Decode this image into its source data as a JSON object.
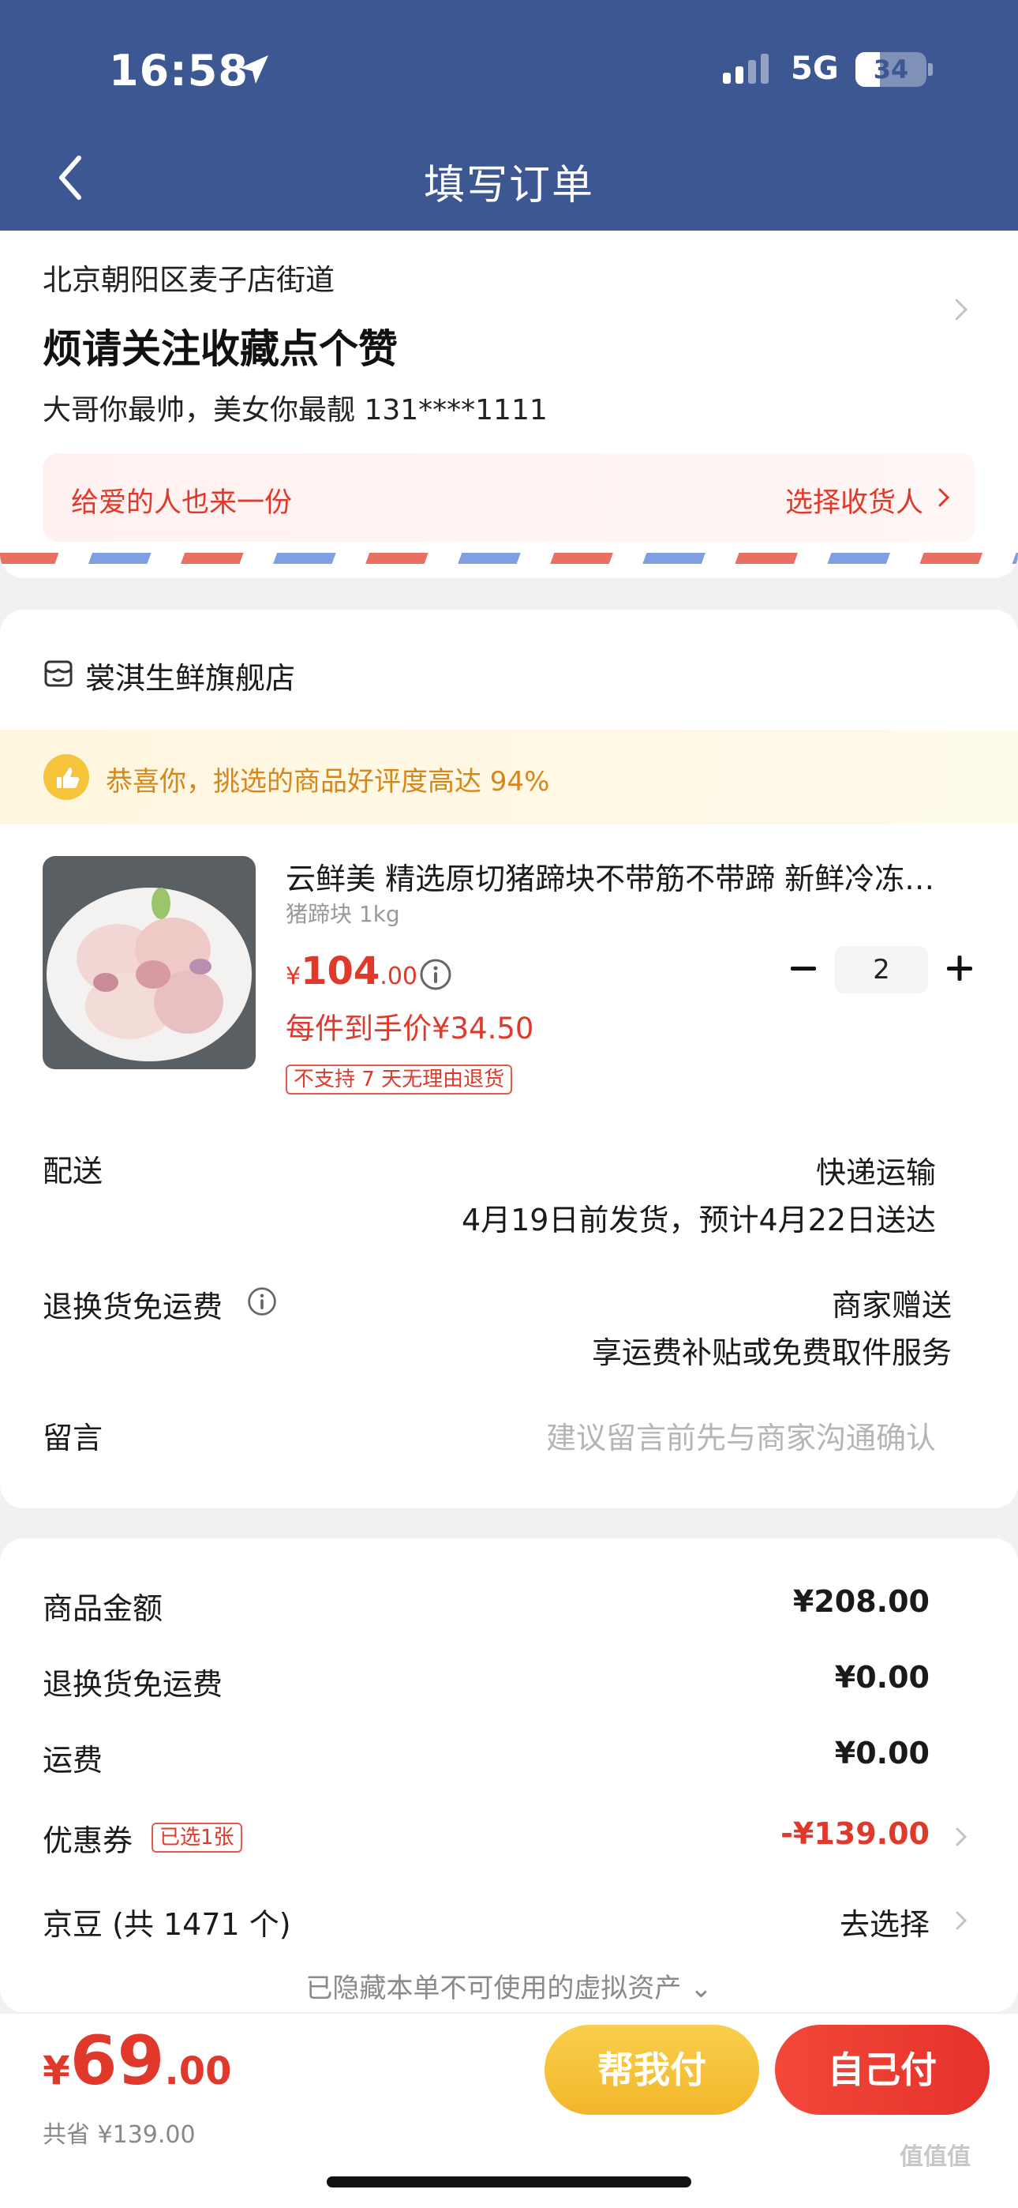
{
  "status_bar": {
    "time": "16:58",
    "network": "5G",
    "battery": "34",
    "battery_level": 0.34
  },
  "nav": {
    "title": "填写订单",
    "back_icon": "chevron-left-icon"
  },
  "address": {
    "region": "北京朝阳区麦子店街道",
    "detail": "烦请关注收藏点个赞",
    "contact": "大哥你最帅，美女你最靓  131****1111",
    "gift_prompt": "给爱的人也来一份",
    "choose_receiver": "选择收货人"
  },
  "shop": {
    "name": "裳淇生鲜旗舰店",
    "praise": "恭喜你，挑选的商品好评度高达 94%"
  },
  "product": {
    "title": "云鲜美 精选原切猪蹄块不带筋不带蹄 新鲜冷冻猪蹄块",
    "spec": "猪蹄块 1kg",
    "price_currency": "¥",
    "price_int": "104",
    "price_dec": ".00",
    "unit_price": "每件到手价¥34.50",
    "no_return_badge": "不支持 7 天无理由退货",
    "quantity": "2"
  },
  "delivery": {
    "label": "配送",
    "method": "快递运输",
    "eta": "4月19日前发货，预计4月22日送达"
  },
  "return_fee": {
    "label": "退换货免运费",
    "value": "商家赠送",
    "desc": "享运费补贴或免费取件服务"
  },
  "note": {
    "label": "留言",
    "placeholder": "建议留言前先与商家沟通确认"
  },
  "totals": {
    "goods_label": "商品金额",
    "goods_value": "¥208.00",
    "rfee_label": "退换货免运费",
    "rfee_value": "¥0.00",
    "ship_label": "运费",
    "ship_value": "¥0.00",
    "coupon_label": "优惠券",
    "coupon_badge": "已选1张",
    "coupon_value": "-¥139.00",
    "jd_label": "京豆 (共 1471 个)",
    "jd_value": "去选择",
    "hidden_assets": "已隐藏本单不可使用的虚拟资产 ⌄"
  },
  "footer": {
    "currency": "¥",
    "total_int": "69",
    "total_dec": ".00",
    "saved": "共省 ¥139.00",
    "help_pay": "帮我付",
    "self_pay": "自己付"
  },
  "watermark": "值值值",
  "colors": {
    "nav_bg": "#3c5792",
    "accent_red": "#e0392b",
    "gold": "#f2b62a"
  }
}
